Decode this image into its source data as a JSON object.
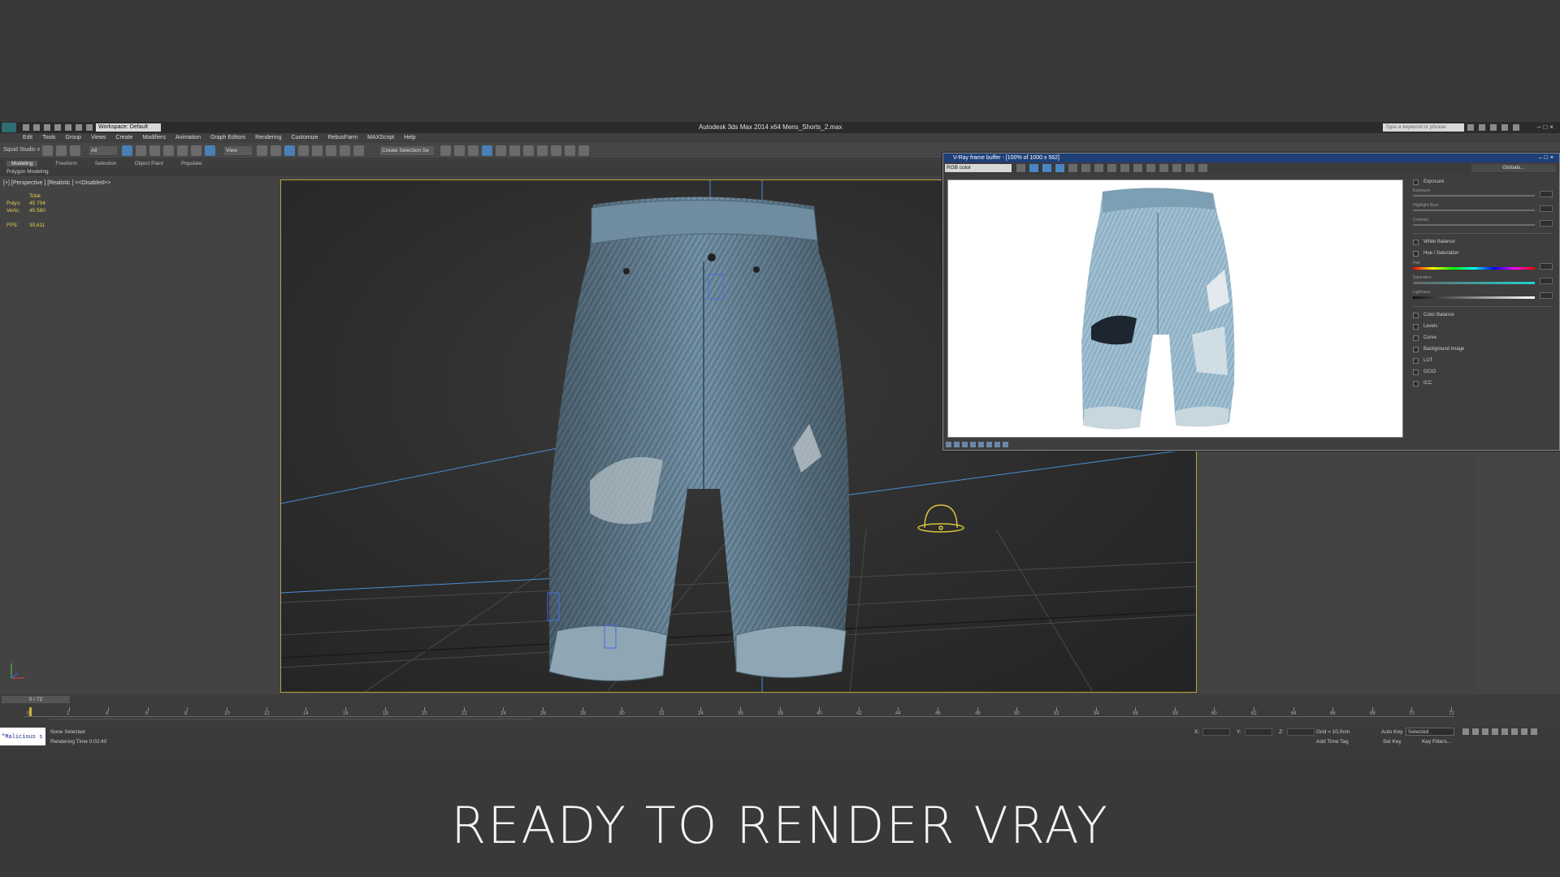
{
  "app": {
    "title": "Autodesk 3ds Max  2014 x64    Mens_Shorts_2.max",
    "workspace": "Workspace: Default",
    "search_placeholder": "Type a keyword or phrase"
  },
  "menu": [
    "Edit",
    "Tools",
    "Group",
    "Views",
    "Create",
    "Modifiers",
    "Animation",
    "Graph Editors",
    "Rendering",
    "Customize",
    "RebusFarm",
    "MAXScript",
    "Help"
  ],
  "toolbar": {
    "studio": "Squid Studio v",
    "filter": "All",
    "view": "View",
    "selection_set": "Create Selection Se"
  },
  "ribbon": {
    "tabs": [
      "Modeling",
      "Freeform",
      "Selection",
      "Object Paint",
      "Populate"
    ],
    "sub": "Polygon Modeling"
  },
  "viewport": {
    "label": "[+] [Perspective ] [Realistic ]  <<Disabled>>",
    "stats": {
      "total_label": "Total",
      "polys_label": "Polys:",
      "polys": "45 704",
      "verts_label": "Verts:",
      "verts": "45 580",
      "fps_label": "FPS:",
      "fps": "30,611"
    }
  },
  "vfb": {
    "title": "V-Ray frame buffer - [100% of 1000 x 562]",
    "channel": "RGB color",
    "globals": "Globals...",
    "panel": {
      "exposure": "Exposure",
      "exposure_sub": "Exposure",
      "highlight_burn": "Highlight Burn",
      "contrast": "Contrast",
      "white_balance": "White Balance",
      "hue_saturation": "Hue / Saturation",
      "hue": "Hue",
      "saturation": "Saturation",
      "lightness": "Lightness",
      "color_balance": "Color Balance",
      "levels": "Levels",
      "curve": "Curve",
      "background_image": "Background Image",
      "lut": "LUT",
      "ocio": "OCIO",
      "icc": "ICC"
    }
  },
  "timeline": {
    "frame": "0 / 72",
    "ticks": [
      0,
      2,
      4,
      6,
      8,
      10,
      12,
      14,
      16,
      18,
      20,
      22,
      24,
      26,
      28,
      30,
      32,
      34,
      36,
      38,
      40,
      42,
      44,
      46,
      48,
      50,
      52,
      54,
      56,
      58,
      60,
      62,
      64,
      66,
      68,
      70,
      72
    ]
  },
  "status": {
    "listener": "\"Malicious s",
    "selection": "None Selected",
    "render_time": "Rendering Time  0:02:40",
    "grid": "Grid = 10,0cm",
    "add_time_tag": "Add Time Tag",
    "auto_key": "Auto Key",
    "selected": "Selected",
    "set_key": "Set Key",
    "key_filters": "Key Filters...",
    "x": "X:",
    "y": "Y:",
    "z": "Z:"
  },
  "caption": "READY TO RENDER VRAY",
  "colors": {
    "background": "#393939",
    "viewport_border": "#b9a432",
    "stats_text": "#e4d34a",
    "vfb_title": "#1e3f78",
    "denim": "#5f7f95"
  }
}
